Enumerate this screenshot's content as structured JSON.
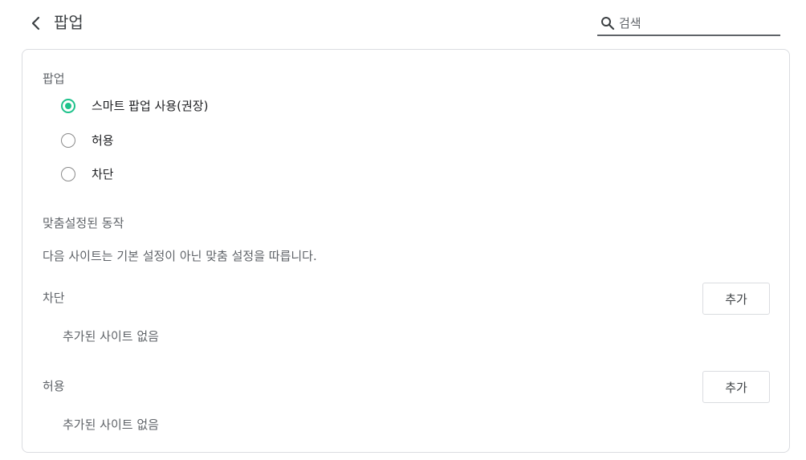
{
  "header": {
    "title": "팝업",
    "search_placeholder": "검색"
  },
  "popup_section": {
    "label": "팝업",
    "options": [
      {
        "label": "스마트 팝업 사용(권장)",
        "checked": true
      },
      {
        "label": "허용",
        "checked": false
      },
      {
        "label": "차단",
        "checked": false
      }
    ]
  },
  "custom_section": {
    "label": "맞춤설정된 동작",
    "description": "다음 사이트는 기본 설정이 아닌 맞춤 설정을 따릅니다.",
    "block": {
      "label": "차단",
      "add_label": "추가",
      "empty_text": "추가된 사이트 없음"
    },
    "allow": {
      "label": "허용",
      "add_label": "추가",
      "empty_text": "추가된 사이트 없음"
    }
  },
  "colors": {
    "accent": "#1ec28b",
    "border": "#dadce0"
  }
}
